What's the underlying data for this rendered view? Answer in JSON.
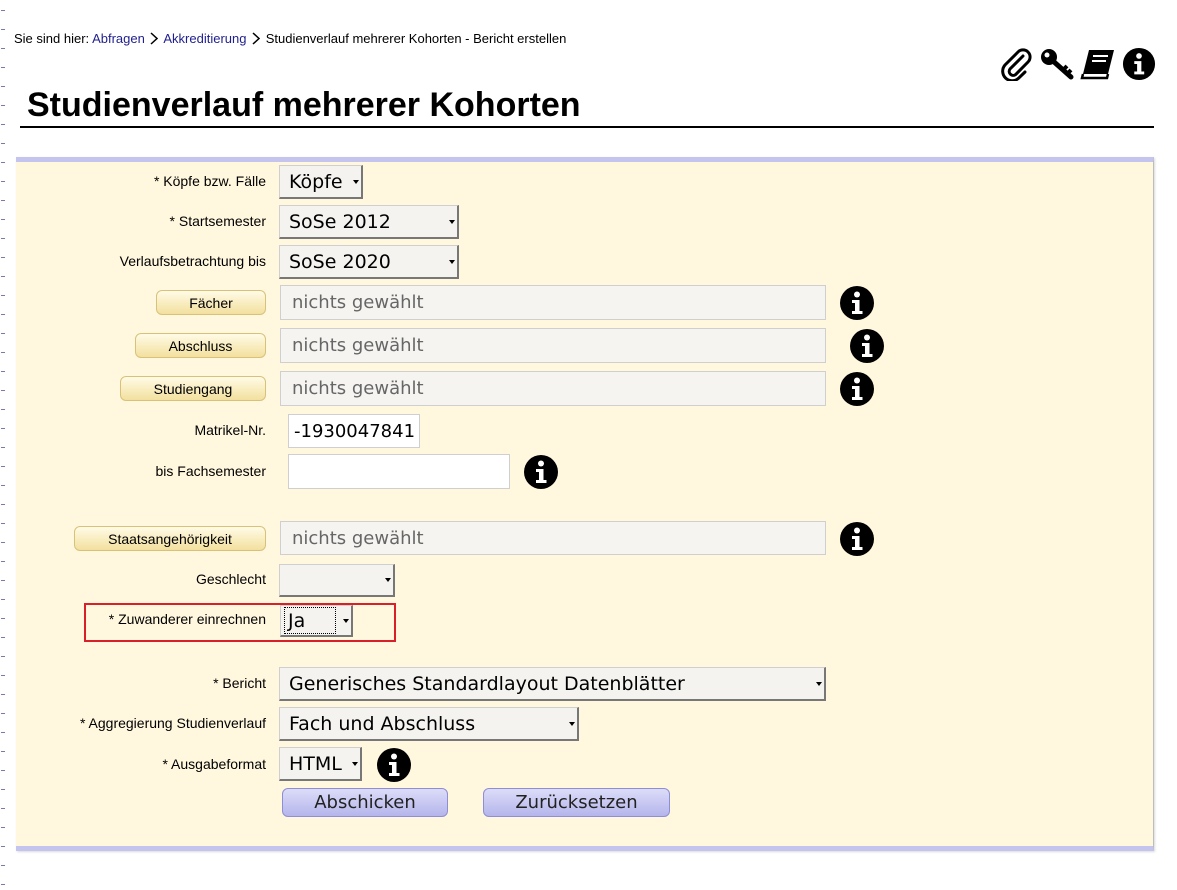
{
  "breadcrumb": {
    "prefix": "Sie sind hier:",
    "items": [
      "Abfragen",
      "Akkreditierung"
    ],
    "current": "Studienverlauf mehrerer Kohorten - Bericht erstellen"
  },
  "toolbar": {
    "icons": [
      "paperclip-icon",
      "key-icon",
      "book-icon",
      "info-icon"
    ]
  },
  "page": {
    "title": "Studienverlauf mehrerer Kohorten"
  },
  "form": {
    "koepfe": {
      "label": "* Köpfe bzw. Fälle",
      "value": "Köpfe"
    },
    "startsemester": {
      "label": "* Startsemester",
      "value": "SoSe 2012"
    },
    "verlauf_bis": {
      "label": "Verlaufsbetrachtung bis",
      "value": "SoSe 2020"
    },
    "faecher": {
      "button": "Fächer",
      "value": "nichts gewählt"
    },
    "abschluss": {
      "button": "Abschluss",
      "value": "nichts gewählt"
    },
    "studiengang": {
      "button": "Studiengang",
      "value": "nichts gewählt"
    },
    "matrikel": {
      "label": "Matrikel-Nr.",
      "value": "-1930047841"
    },
    "bis_fachsemester": {
      "label": "bis Fachsemester",
      "value": ""
    },
    "staatsangehoerigkeit": {
      "button": "Staatsangehörigkeit",
      "value": "nichts gewählt"
    },
    "geschlecht": {
      "label": "Geschlecht",
      "value": ""
    },
    "zuwanderer": {
      "label": "* Zuwanderer einrechnen",
      "value": "Ja"
    },
    "bericht": {
      "label": "* Bericht",
      "value": "Generisches Standardlayout Datenblätter"
    },
    "aggregierung": {
      "label": "* Aggregierung Studienverlauf",
      "value": "Fach und Abschluss"
    },
    "ausgabeformat": {
      "label": "* Ausgabeformat",
      "value": "HTML"
    }
  },
  "actions": {
    "submit": "Abschicken",
    "reset": "Zurücksetzen"
  },
  "colors": {
    "panel_bg": "#fff8de",
    "panel_border": "#c4c4ee",
    "link": "#1f1f8f",
    "highlight": "#d8202a"
  }
}
